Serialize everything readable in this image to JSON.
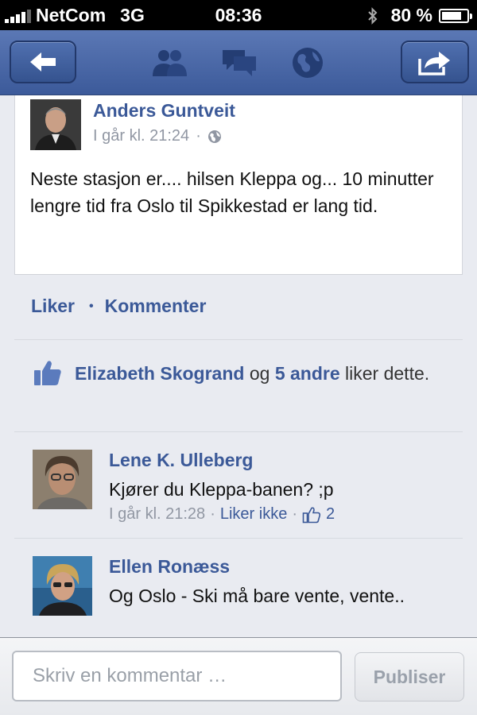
{
  "status_bar": {
    "carrier": "NetCom",
    "network": "3G",
    "time": "08:36",
    "battery": "80 %",
    "battery_level": 0.8
  },
  "nav": {
    "icons": [
      "back-arrow-icon",
      "friends-icon",
      "messages-icon",
      "globe-icon",
      "share-icon"
    ],
    "accent": "#3b5998"
  },
  "post": {
    "author": "Anders Guntveit",
    "timestamp": "I går kl. 21:24",
    "separator": "·",
    "text": "Neste stasjon er.... hilsen Kleppa og... 10 minutter lengre tid fra Oslo til Spikkestad er lang tid."
  },
  "actions": {
    "like": "Liker",
    "separator": "•",
    "comment": "Kommenter"
  },
  "likes": {
    "name": "Elizabeth Skogrand",
    "joiner": " og ",
    "others": "5 andre",
    "suffix": " liker dette."
  },
  "comments": [
    {
      "author": "Lene K. Ulleberg",
      "text": "Kjører du Kleppa-banen?  ;p",
      "timestamp": "I går kl. 21:28",
      "separator": "·",
      "unlike": "Liker ikke",
      "like_count": "2"
    },
    {
      "author": "Ellen Ronæss",
      "text": "Og Oslo - Ski må bare vente, vente.."
    }
  ],
  "composer": {
    "placeholder": "Skriv en kommentar …",
    "submit": "Publiser"
  }
}
